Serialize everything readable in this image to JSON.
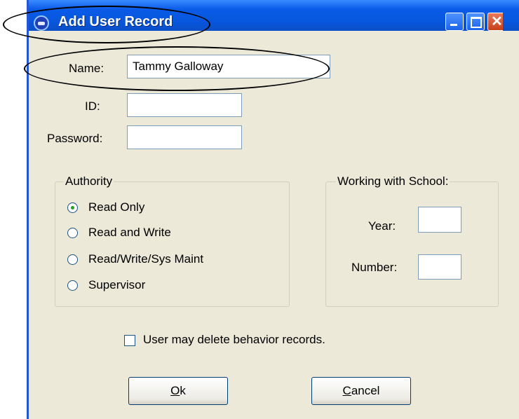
{
  "window": {
    "title": "Add User Record"
  },
  "form": {
    "name_label": "Name:",
    "name_value": "Tammy Galloway",
    "id_label": "ID:",
    "id_value": "",
    "password_label": "Password:",
    "password_value": ""
  },
  "authority": {
    "legend": "Authority",
    "options": [
      {
        "label": "Read Only",
        "selected": true
      },
      {
        "label": "Read and Write",
        "selected": false
      },
      {
        "label": "Read/Write/Sys Maint",
        "selected": false
      },
      {
        "label": "Supervisor",
        "selected": false
      }
    ]
  },
  "school": {
    "legend": "Working with School:",
    "year_label": "Year:",
    "year_value": "",
    "number_label": "Number:",
    "number_value": ""
  },
  "delete_option": {
    "label": "User may delete behavior records.",
    "checked": false
  },
  "buttons": {
    "ok_label_mnemonic": "O",
    "ok_label_rest": "k",
    "cancel_label_mnemonic": "C",
    "cancel_label_rest": "ancel"
  },
  "icons": {
    "app": "app-icon",
    "minimize": "minimize-icon",
    "maximize": "maximize-icon",
    "close": "close-icon"
  },
  "colors": {
    "titlebar": "#0a5be8",
    "dialog_bg": "#ece9d8",
    "close_button": "#c7401a"
  }
}
